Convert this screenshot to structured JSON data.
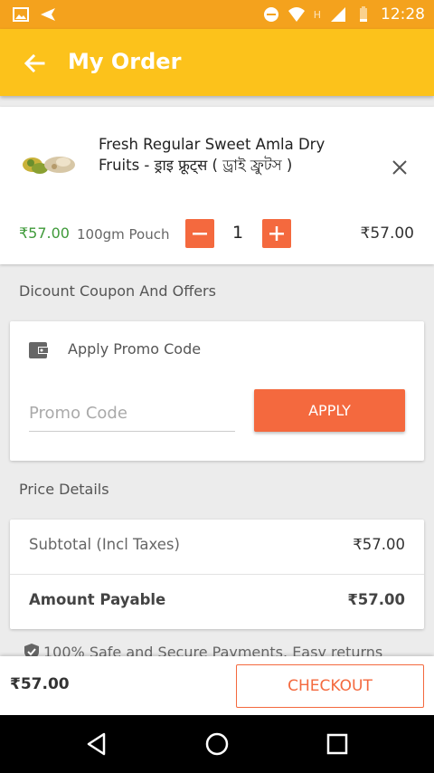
{
  "status_bar": {
    "time": "12:28",
    "network_label": "H",
    "icons": [
      "gallery-icon",
      "send-icon",
      "minus-circle-icon",
      "wifi-icon",
      "signal-icon",
      "battery-icon"
    ]
  },
  "header": {
    "title": "My Order",
    "back_icon": "arrow-back-icon"
  },
  "cart_item": {
    "name": "Fresh Regular Sweet Amla Dry Fruits - ड्राइ फ्रूट्स ( ড্রাই ফ্রুটস )",
    "price": "₹57.00",
    "pack": "100gm Pouch",
    "quantity": "1",
    "total": "₹57.00"
  },
  "coupon_section": {
    "heading": "Dicount Coupon And Offers",
    "title": "Apply Promo Code",
    "placeholder": "Promo Code",
    "value": "",
    "apply_label": "APPLY"
  },
  "price_details": {
    "heading": "Price Details",
    "rows": [
      {
        "label": "Subtotal (Incl Taxes)",
        "value": "₹57.00"
      },
      {
        "label": "Amount Payable",
        "value": "₹57.00"
      }
    ]
  },
  "safe_note": "100% Safe and Secure Payments. Easy returns",
  "footer": {
    "total": "₹57.00",
    "checkout_label": "CHECKOUT"
  },
  "colors": {
    "status_bar": "#f4a21d",
    "app_bar": "#fcc21b",
    "accent": "#f4693e",
    "price_green": "#3f9a3a",
    "background": "#ececec"
  }
}
